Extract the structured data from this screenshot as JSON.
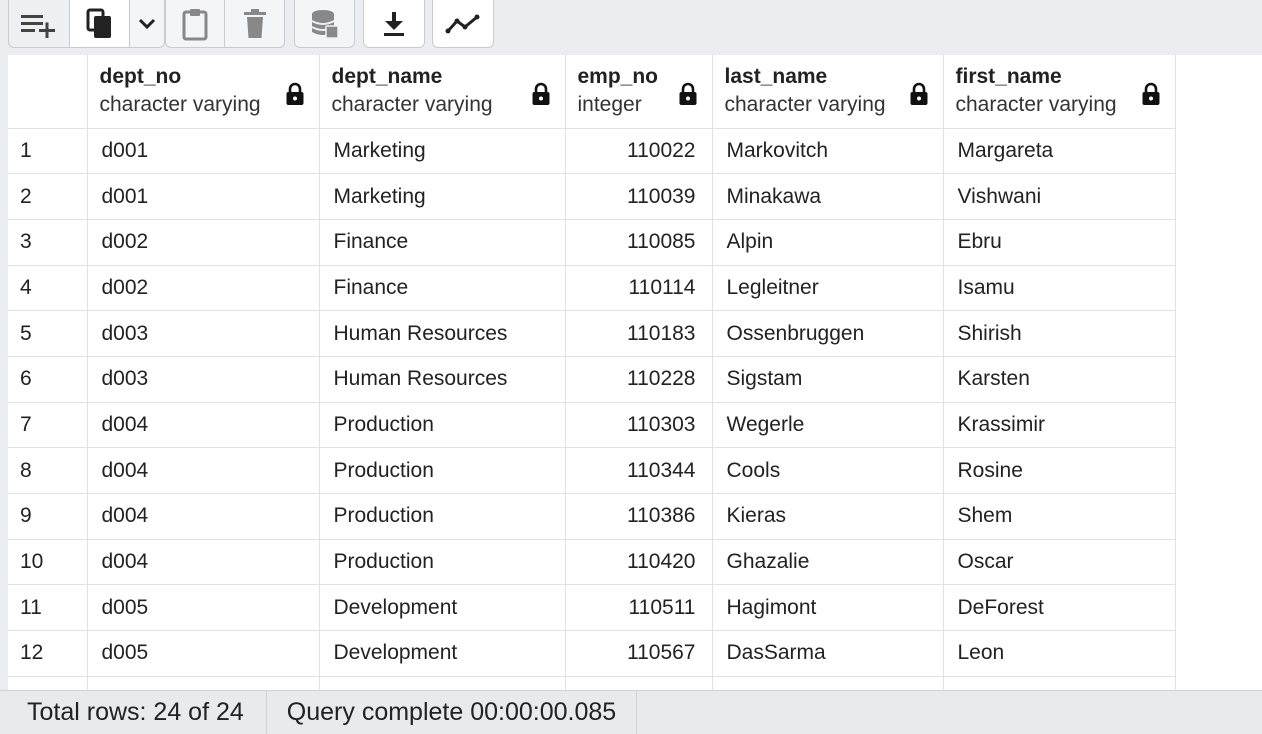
{
  "toolbar": {
    "icons": [
      "add-row-icon",
      "copy-icon",
      "chevron-down-icon",
      "paste-icon",
      "delete-icon",
      "save-data-icon",
      "download-icon",
      "graph-visualiser-icon"
    ]
  },
  "grid": {
    "columns": [
      {
        "name": "dept_no",
        "type": "character varying"
      },
      {
        "name": "dept_name",
        "type": "character varying"
      },
      {
        "name": "emp_no",
        "type": "integer"
      },
      {
        "name": "last_name",
        "type": "character varying"
      },
      {
        "name": "first_name",
        "type": "character varying"
      }
    ],
    "rows": [
      {
        "n": "1",
        "dept_no": "d001",
        "dept_name": "Marketing",
        "emp_no": "110022",
        "last_name": "Markovitch",
        "first_name": "Margareta"
      },
      {
        "n": "2",
        "dept_no": "d001",
        "dept_name": "Marketing",
        "emp_no": "110039",
        "last_name": "Minakawa",
        "first_name": "Vishwani"
      },
      {
        "n": "3",
        "dept_no": "d002",
        "dept_name": "Finance",
        "emp_no": "110085",
        "last_name": "Alpin",
        "first_name": "Ebru"
      },
      {
        "n": "4",
        "dept_no": "d002",
        "dept_name": "Finance",
        "emp_no": "110114",
        "last_name": "Legleitner",
        "first_name": "Isamu"
      },
      {
        "n": "5",
        "dept_no": "d003",
        "dept_name": "Human Resources",
        "emp_no": "110183",
        "last_name": "Ossenbruggen",
        "first_name": "Shirish"
      },
      {
        "n": "6",
        "dept_no": "d003",
        "dept_name": "Human Resources",
        "emp_no": "110228",
        "last_name": "Sigstam",
        "first_name": "Karsten"
      },
      {
        "n": "7",
        "dept_no": "d004",
        "dept_name": "Production",
        "emp_no": "110303",
        "last_name": "Wegerle",
        "first_name": "Krassimir"
      },
      {
        "n": "8",
        "dept_no": "d004",
        "dept_name": "Production",
        "emp_no": "110344",
        "last_name": "Cools",
        "first_name": "Rosine"
      },
      {
        "n": "9",
        "dept_no": "d004",
        "dept_name": "Production",
        "emp_no": "110386",
        "last_name": "Kieras",
        "first_name": "Shem"
      },
      {
        "n": "10",
        "dept_no": "d004",
        "dept_name": "Production",
        "emp_no": "110420",
        "last_name": "Ghazalie",
        "first_name": "Oscar"
      },
      {
        "n": "11",
        "dept_no": "d005",
        "dept_name": "Development",
        "emp_no": "110511",
        "last_name": "Hagimont",
        "first_name": "DeForest"
      },
      {
        "n": "12",
        "dept_no": "d005",
        "dept_name": "Development",
        "emp_no": "110567",
        "last_name": "DasSarma",
        "first_name": "Leon"
      }
    ]
  },
  "status": {
    "total_rows": "Total rows: 24 of 24",
    "query_complete": "Query complete 00:00:00.085"
  }
}
